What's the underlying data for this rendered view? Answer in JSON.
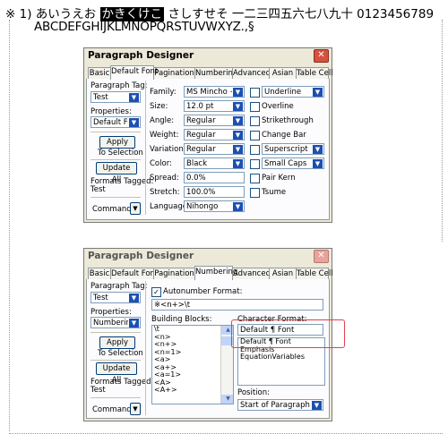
{
  "header": {
    "line1_a": "※ 1) あいうえお ",
    "line1_hl": "かきくけこ",
    "line1_b": " さしすせそ 一二三四五六七八九十 0123456789",
    "line2": "ABCDEFGHIJKLMNOPQRSTUVWXYZ.,§"
  },
  "dialog1": {
    "title": "Paragraph Designer",
    "close": "✕",
    "tabs": [
      "Basic",
      "Default Font",
      "Pagination",
      "Numbering",
      "Advanced",
      "Asian",
      "Table Cell"
    ],
    "selected_tab": "Default Font",
    "paragraph_tag_label": "Paragraph Tag:",
    "paragraph_tag_value": "Test",
    "properties_label": "Properties:",
    "properties_value": "Default Font",
    "apply": "Apply",
    "to_selection": "To Selection",
    "update_all": "Update All",
    "formats_tagged_label": "Formats Tagged:",
    "formats_tagged_value": "Test",
    "commands": "Commands:",
    "family_label": "Family:",
    "family_value": "MS Mincho + Aria",
    "size_label": "Size:",
    "size_value": "12.0 pt",
    "angle_label": "Angle:",
    "angle_value": "Regular",
    "weight_label": "Weight:",
    "weight_value": "Regular",
    "variation_label": "Variation:",
    "variation_value": "Regular",
    "color_label": "Color:",
    "color_value": "Black",
    "spread_label": "Spread:",
    "spread_value": "0.0%",
    "stretch_label": "Stretch:",
    "stretch_value": "100.0%",
    "language_label": "Language:",
    "language_value": "Nihongo",
    "underline": "Underline",
    "overline": "Overline",
    "strikethrough": "Strikethrough",
    "change_bar": "Change Bar",
    "superscript": "Superscript",
    "small_caps": "Small Caps",
    "pair_kern": "Pair Kern",
    "tsume": "Tsume"
  },
  "dialog2": {
    "title": "Paragraph Designer",
    "close": "✕",
    "tabs": [
      "Basic",
      "Default Font",
      "Pagination",
      "Numbering",
      "Advanced",
      "Asian",
      "Table Cell"
    ],
    "selected_tab": "Numbering",
    "paragraph_tag_label": "Paragraph Tag:",
    "paragraph_tag_value": "Test",
    "properties_label": "Properties:",
    "properties_value": "Numbering",
    "apply": "Apply",
    "to_selection": "To Selection",
    "update_all": "Update All",
    "formats_tagged_label": "Formats Tagged:",
    "formats_tagged_value": "Test",
    "commands": "Commands:",
    "autonumber_label": "Autonumber Format:",
    "autonumber_value": "※<n+>\\t",
    "building_blocks_label": "Building Blocks:",
    "building_blocks": [
      " ",
      "\\t",
      "<n>",
      "<n+>",
      "<n=1>",
      "<a>",
      "<a+>",
      "<a=1>",
      "<A>",
      "<A+>"
    ],
    "character_format_label": "Character Format:",
    "character_format_value": "Default ¶ Font",
    "character_formats": [
      "Default ¶ Font",
      "Emphasis",
      "EquationVariables"
    ],
    "position_label": "Position:",
    "position_value": "Start of Paragraph"
  }
}
